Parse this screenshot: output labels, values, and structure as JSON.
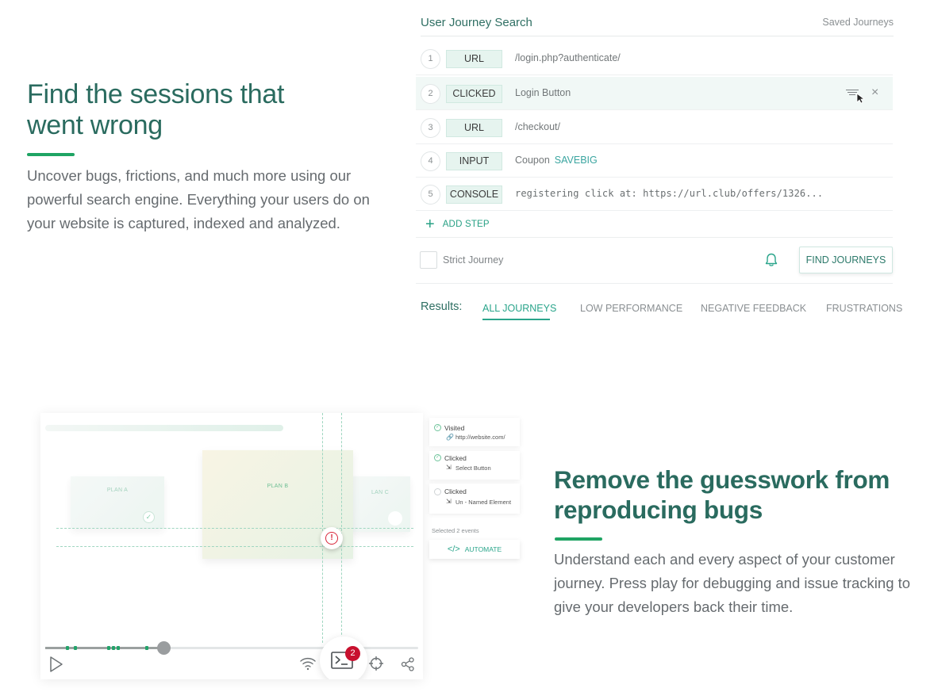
{
  "section1": {
    "title_line1": "Find the sessions that",
    "title_line2": "went wrong",
    "body": "Uncover bugs, frictions, and much more using our powerful search engine. Everything your users do on your website is captured, indexed and analyzed."
  },
  "journey_search": {
    "title": "User Journey Search",
    "saved_link": "Saved Journeys",
    "steps": [
      {
        "num": "1",
        "type": "URL",
        "value": "/login.php?authenticate/"
      },
      {
        "num": "2",
        "type": "CLICKED",
        "value": "Login Button"
      },
      {
        "num": "3",
        "type": "URL",
        "value": "/checkout/"
      },
      {
        "num": "4",
        "type": "INPUT",
        "value": "Coupon",
        "accent": "SAVEBIG"
      },
      {
        "num": "5",
        "type": "CONSOLE",
        "value": "registering click at: https://url.club/offers/1326..."
      }
    ],
    "add_step": "ADD STEP",
    "strict_label": "Strict Journey",
    "find_button": "FIND JOURNEYS",
    "results_label": "Results:",
    "tabs": [
      "ALL JOURNEYS",
      "LOW PERFORMANCE",
      "NEGATIVE FEEDBACK",
      "FRUSTRATIONS"
    ]
  },
  "player": {
    "cards": [
      "PLAN A",
      "PLAN B",
      "LAN C"
    ],
    "console_badge": "2",
    "events": [
      {
        "title": "Visited",
        "detail": "http://website.com/",
        "checked": true
      },
      {
        "title": "Clicked",
        "detail": "Select Button",
        "checked": true
      },
      {
        "title": "Clicked",
        "detail": "Un - Named Element",
        "checked": false
      }
    ],
    "selected_events": "Selected 2 events",
    "automate_label": "AUTOMATE",
    "automate_icon": "</>"
  },
  "section2": {
    "title_line1": "Remove the guesswork from",
    "title_line2": "reproducing bugs",
    "body": "Understand each and every aspect of your customer journey. Press play for debugging and issue tracking to give your developers back their time."
  },
  "colors": {
    "brand_green": "#2a6b5f",
    "accent": "#1fa463",
    "teal": "#2aa58b",
    "alert_red": "#d8263a"
  }
}
